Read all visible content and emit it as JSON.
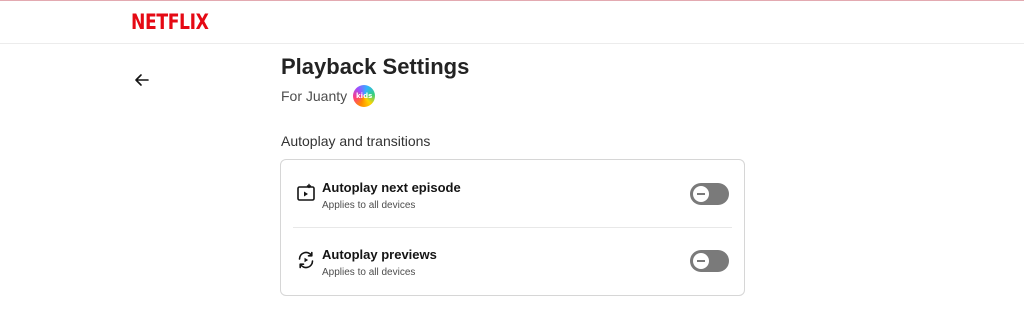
{
  "brand": {
    "logo_text": "NETFLIX",
    "color": "#e50914"
  },
  "header": {
    "back_icon": "arrow-left-icon",
    "title": "Playback Settings",
    "profile_prefix": "For Juanty",
    "profile_badge": "kids"
  },
  "section": {
    "heading": "Autoplay and transitions",
    "items": [
      {
        "icon": "autoplay-next-episode-icon",
        "title": "Autoplay next episode",
        "subtitle": "Applies to all devices",
        "enabled": false
      },
      {
        "icon": "autoplay-previews-icon",
        "title": "Autoplay previews",
        "subtitle": "Applies to all devices",
        "enabled": false
      }
    ]
  },
  "colors": {
    "toggle_off": "#7a7a7a",
    "card_border": "#d6d6d6"
  }
}
